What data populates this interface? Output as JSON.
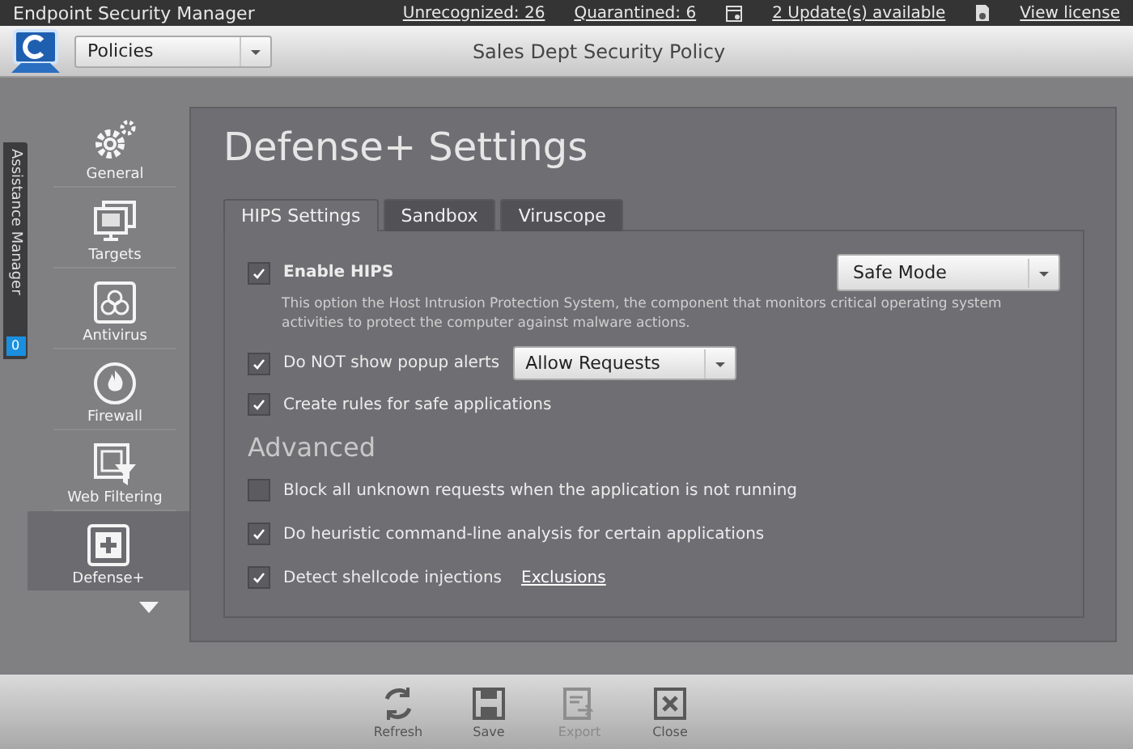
{
  "title_bar": {
    "title": "Endpoint Security Manager",
    "links": [
      {
        "label": "Unrecognized: 26"
      },
      {
        "label": "Quarantined: 6"
      },
      {
        "label": "2 Update(s) available"
      },
      {
        "label": "View license"
      }
    ]
  },
  "header": {
    "dropdown": "Policies",
    "policy_name": "Sales Dept Security Policy"
  },
  "assistance": {
    "label": "Assistance Manager",
    "count": "0"
  },
  "sidebar": {
    "items": [
      {
        "label": "General",
        "selected": false
      },
      {
        "label": "Targets",
        "selected": false
      },
      {
        "label": "Antivirus",
        "selected": false
      },
      {
        "label": "Firewall",
        "selected": false
      },
      {
        "label": "Web Filtering",
        "selected": false
      },
      {
        "label": "Defense+",
        "selected": true
      }
    ]
  },
  "panel": {
    "title": "Defense+ Settings",
    "tabs": [
      {
        "label": "HIPS Settings",
        "selected": true
      },
      {
        "label": "Sandbox",
        "selected": false
      },
      {
        "label": "Viruscope",
        "selected": false
      }
    ],
    "options": [
      {
        "kind": "master",
        "label": "Enable HIPS",
        "checked": true,
        "dropdown": "Safe Mode",
        "description": "This option the Host Intrusion Protection System, the component that monitors critical operating system activities to protect the computer against malware actions."
      },
      {
        "kind": "inline",
        "label": "Do NOT show popup alerts",
        "checked": true,
        "dropdown": "Allow Requests"
      },
      {
        "kind": "plain",
        "label": "Create rules for safe applications",
        "checked": true
      }
    ],
    "advanced_heading": "Advanced",
    "advanced_options": [
      {
        "label": "Block all unknown requests when the application is not running",
        "checked": false
      },
      {
        "label": "Do heuristic command-line analysis for certain applications",
        "checked": true
      },
      {
        "label": "Detect shellcode injections",
        "checked": true,
        "link": "Exclusions"
      }
    ]
  },
  "toolbar": [
    {
      "label": "Refresh",
      "disabled": false
    },
    {
      "label": "Save",
      "disabled": false
    },
    {
      "label": "Export",
      "disabled": true
    },
    {
      "label": "Close",
      "disabled": false
    }
  ]
}
